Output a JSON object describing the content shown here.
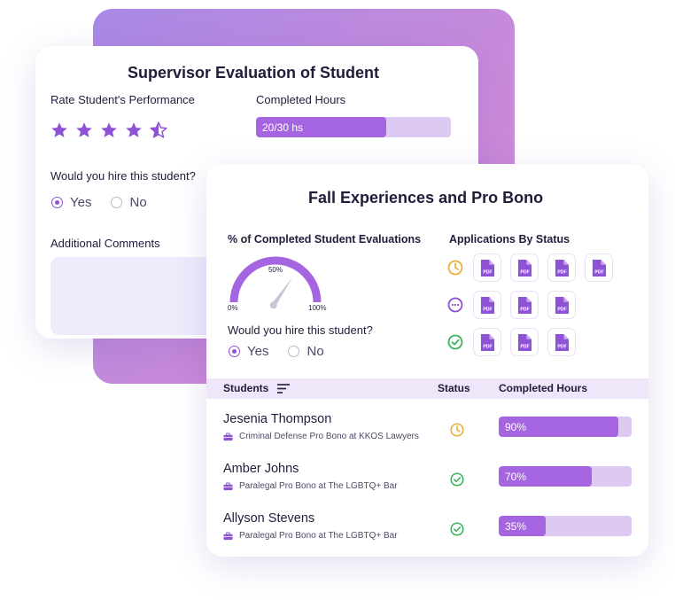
{
  "colors": {
    "accent": "#a565e0",
    "accent_light": "#dccaf3",
    "pending": "#e8b23a",
    "done": "#3cb35d",
    "review": "#8e52d6"
  },
  "evaluation": {
    "title": "Supervisor Evaluation of Student",
    "rate_label": "Rate Student's Performance",
    "rating": 4.5,
    "rating_max": 5,
    "hours_label": "Completed Hours",
    "hours_text": "20/30 hs",
    "hours_fraction": 0.6667,
    "hire_question": "Would you hire this student?",
    "yes": "Yes",
    "no": "No",
    "comments_label": "Additional Comments"
  },
  "fall": {
    "title": "Fall Experiences and Pro Bono",
    "gauge_label": "% of Completed Student Evaluations",
    "gauge_value": 50,
    "gauge_min": "0%",
    "gauge_mid": "50%",
    "gauge_max": "100%",
    "hire_question": "Would you hire this student?",
    "yes": "Yes",
    "no": "No",
    "apps_label": "Applications By Status",
    "pdf_text": "PDF",
    "app_rows": [
      {
        "status_icon": "clock-icon",
        "count": 4
      },
      {
        "status_icon": "more-icon",
        "count": 3
      },
      {
        "status_icon": "check-circle-icon",
        "count": 3
      }
    ],
    "table": {
      "col_students": "Students",
      "col_status": "Status",
      "col_hours": "Completed Hours",
      "rows": [
        {
          "name": "Jesenia Thompson",
          "program": "Criminal Defense Pro Bono at KKOS Lawyers",
          "status_icon": "clock-icon",
          "hours_text": "90%",
          "hours_fraction": 0.9
        },
        {
          "name": "Amber Johns",
          "program": "Paralegal Pro Bono at The LGBTQ+ Bar",
          "status_icon": "check-circle-icon",
          "hours_text": "70%",
          "hours_fraction": 0.7
        },
        {
          "name": "Allyson Stevens",
          "program": "Paralegal Pro Bono at The LGBTQ+ Bar",
          "status_icon": "check-circle-icon",
          "hours_text": "35%",
          "hours_fraction": 0.35
        }
      ]
    }
  }
}
